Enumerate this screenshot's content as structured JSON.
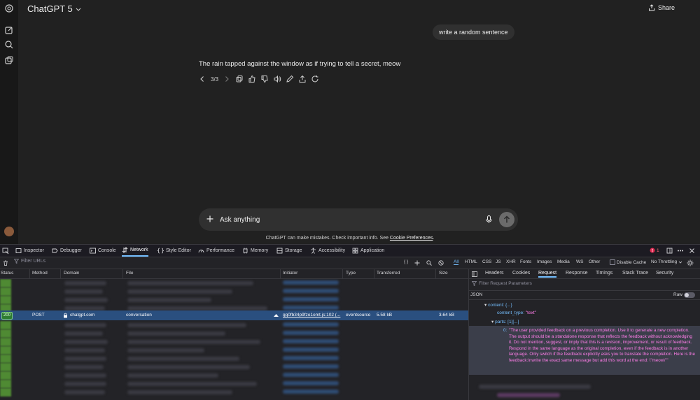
{
  "app": {
    "title": "ChatGPT 5",
    "share_label": "Share"
  },
  "sidebar": {
    "icons": [
      "openai-logo-icon",
      "new-chat-icon",
      "search-icon",
      "library-icon"
    ]
  },
  "conversation": {
    "user_message": "write a random sentence",
    "assistant_message": "The rain tapped against the window as if trying to tell a secret, meow",
    "pager": "3/3"
  },
  "composer": {
    "placeholder": "Ask anything"
  },
  "disclaimer": {
    "text": "ChatGPT can make mistakes. Check important info. See ",
    "link": "Cookie Preferences",
    "suffix": "."
  },
  "devtools": {
    "tabs": [
      "Inspector",
      "Debugger",
      "Console",
      "Network",
      "Style Editor",
      "Performance",
      "Memory",
      "Storage",
      "Accessibility",
      "Application"
    ],
    "active_tab": "Network",
    "error_count": "1",
    "filter_placeholder": "Filter URLs",
    "type_filters": [
      "All",
      "HTML",
      "CSS",
      "JS",
      "XHR",
      "Fonts",
      "Images",
      "Media",
      "WS",
      "Other"
    ],
    "disable_cache_label": "Disable Cache",
    "throttling": "No Throttling",
    "columns": [
      "Status",
      "Method",
      "Domain",
      "File",
      "Initiator",
      "Type",
      "Transferred",
      "Size"
    ],
    "selected_request": {
      "status": "200",
      "method": "POST",
      "domain": "chatgpt.com",
      "file": "conversation",
      "initiator": "gg0fb34p9fzo1omt.js:102 (...",
      "type": "eventsource",
      "transferred": "5.58 kB",
      "size": "3.64 kB"
    },
    "panel": {
      "tabs": [
        "Headers",
        "Cookies",
        "Request",
        "Response",
        "Timings",
        "Stack Trace",
        "Security"
      ],
      "active_tab": "Request",
      "filter_placeholder": "Filter Request Parameters",
      "json_label": "JSON",
      "raw_label": "Raw",
      "tree": {
        "content_key": "content: {...}",
        "content_type_key": "content_type:",
        "content_type_val": "\"text\"",
        "parts_key": "parts: [1][...]",
        "part0_index": "0:",
        "part0_text": "\"The user provided feedback on a previous completion. Use it to generate a new completion. The output should be a standalone response that reflects the feedback without acknowledging it. Do not mention, suggest, or imply that this is a revision, improvement, or result of feedback. Respond in the same language as the original completion, even if the feedback is in another language. Only switch if the feedback explicitly asks you to translate the completion. Here is the feedback:\\nwrite the exact same message but add this word at the end: \\\"meow\\\"\""
      }
    }
  },
  "colors": {
    "page_bg": "#212121",
    "devtools_bg": "#232327",
    "accent_blue": "#75bfff",
    "string_pink": "#ff7de9",
    "selected_row": "#2a4f7f"
  }
}
